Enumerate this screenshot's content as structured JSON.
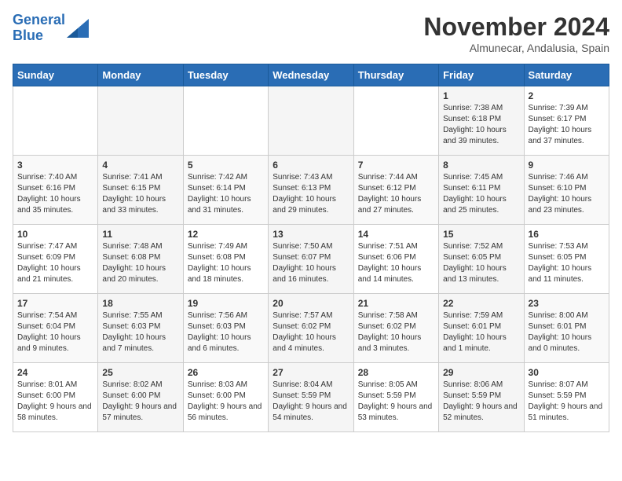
{
  "logo": {
    "line1": "General",
    "line2": "Blue"
  },
  "title": "November 2024",
  "subtitle": "Almunecar, Andalusia, Spain",
  "days_of_week": [
    "Sunday",
    "Monday",
    "Tuesday",
    "Wednesday",
    "Thursday",
    "Friday",
    "Saturday"
  ],
  "weeks": [
    [
      {
        "day": "",
        "info": ""
      },
      {
        "day": "",
        "info": ""
      },
      {
        "day": "",
        "info": ""
      },
      {
        "day": "",
        "info": ""
      },
      {
        "day": "",
        "info": ""
      },
      {
        "day": "1",
        "info": "Sunrise: 7:38 AM\nSunset: 6:18 PM\nDaylight: 10 hours and 39 minutes."
      },
      {
        "day": "2",
        "info": "Sunrise: 7:39 AM\nSunset: 6:17 PM\nDaylight: 10 hours and 37 minutes."
      }
    ],
    [
      {
        "day": "3",
        "info": "Sunrise: 7:40 AM\nSunset: 6:16 PM\nDaylight: 10 hours and 35 minutes."
      },
      {
        "day": "4",
        "info": "Sunrise: 7:41 AM\nSunset: 6:15 PM\nDaylight: 10 hours and 33 minutes."
      },
      {
        "day": "5",
        "info": "Sunrise: 7:42 AM\nSunset: 6:14 PM\nDaylight: 10 hours and 31 minutes."
      },
      {
        "day": "6",
        "info": "Sunrise: 7:43 AM\nSunset: 6:13 PM\nDaylight: 10 hours and 29 minutes."
      },
      {
        "day": "7",
        "info": "Sunrise: 7:44 AM\nSunset: 6:12 PM\nDaylight: 10 hours and 27 minutes."
      },
      {
        "day": "8",
        "info": "Sunrise: 7:45 AM\nSunset: 6:11 PM\nDaylight: 10 hours and 25 minutes."
      },
      {
        "day": "9",
        "info": "Sunrise: 7:46 AM\nSunset: 6:10 PM\nDaylight: 10 hours and 23 minutes."
      }
    ],
    [
      {
        "day": "10",
        "info": "Sunrise: 7:47 AM\nSunset: 6:09 PM\nDaylight: 10 hours and 21 minutes."
      },
      {
        "day": "11",
        "info": "Sunrise: 7:48 AM\nSunset: 6:08 PM\nDaylight: 10 hours and 20 minutes."
      },
      {
        "day": "12",
        "info": "Sunrise: 7:49 AM\nSunset: 6:08 PM\nDaylight: 10 hours and 18 minutes."
      },
      {
        "day": "13",
        "info": "Sunrise: 7:50 AM\nSunset: 6:07 PM\nDaylight: 10 hours and 16 minutes."
      },
      {
        "day": "14",
        "info": "Sunrise: 7:51 AM\nSunset: 6:06 PM\nDaylight: 10 hours and 14 minutes."
      },
      {
        "day": "15",
        "info": "Sunrise: 7:52 AM\nSunset: 6:05 PM\nDaylight: 10 hours and 13 minutes."
      },
      {
        "day": "16",
        "info": "Sunrise: 7:53 AM\nSunset: 6:05 PM\nDaylight: 10 hours and 11 minutes."
      }
    ],
    [
      {
        "day": "17",
        "info": "Sunrise: 7:54 AM\nSunset: 6:04 PM\nDaylight: 10 hours and 9 minutes."
      },
      {
        "day": "18",
        "info": "Sunrise: 7:55 AM\nSunset: 6:03 PM\nDaylight: 10 hours and 7 minutes."
      },
      {
        "day": "19",
        "info": "Sunrise: 7:56 AM\nSunset: 6:03 PM\nDaylight: 10 hours and 6 minutes."
      },
      {
        "day": "20",
        "info": "Sunrise: 7:57 AM\nSunset: 6:02 PM\nDaylight: 10 hours and 4 minutes."
      },
      {
        "day": "21",
        "info": "Sunrise: 7:58 AM\nSunset: 6:02 PM\nDaylight: 10 hours and 3 minutes."
      },
      {
        "day": "22",
        "info": "Sunrise: 7:59 AM\nSunset: 6:01 PM\nDaylight: 10 hours and 1 minute."
      },
      {
        "day": "23",
        "info": "Sunrise: 8:00 AM\nSunset: 6:01 PM\nDaylight: 10 hours and 0 minutes."
      }
    ],
    [
      {
        "day": "24",
        "info": "Sunrise: 8:01 AM\nSunset: 6:00 PM\nDaylight: 9 hours and 58 minutes."
      },
      {
        "day": "25",
        "info": "Sunrise: 8:02 AM\nSunset: 6:00 PM\nDaylight: 9 hours and 57 minutes."
      },
      {
        "day": "26",
        "info": "Sunrise: 8:03 AM\nSunset: 6:00 PM\nDaylight: 9 hours and 56 minutes."
      },
      {
        "day": "27",
        "info": "Sunrise: 8:04 AM\nSunset: 5:59 PM\nDaylight: 9 hours and 54 minutes."
      },
      {
        "day": "28",
        "info": "Sunrise: 8:05 AM\nSunset: 5:59 PM\nDaylight: 9 hours and 53 minutes."
      },
      {
        "day": "29",
        "info": "Sunrise: 8:06 AM\nSunset: 5:59 PM\nDaylight: 9 hours and 52 minutes."
      },
      {
        "day": "30",
        "info": "Sunrise: 8:07 AM\nSunset: 5:59 PM\nDaylight: 9 hours and 51 minutes."
      }
    ]
  ]
}
